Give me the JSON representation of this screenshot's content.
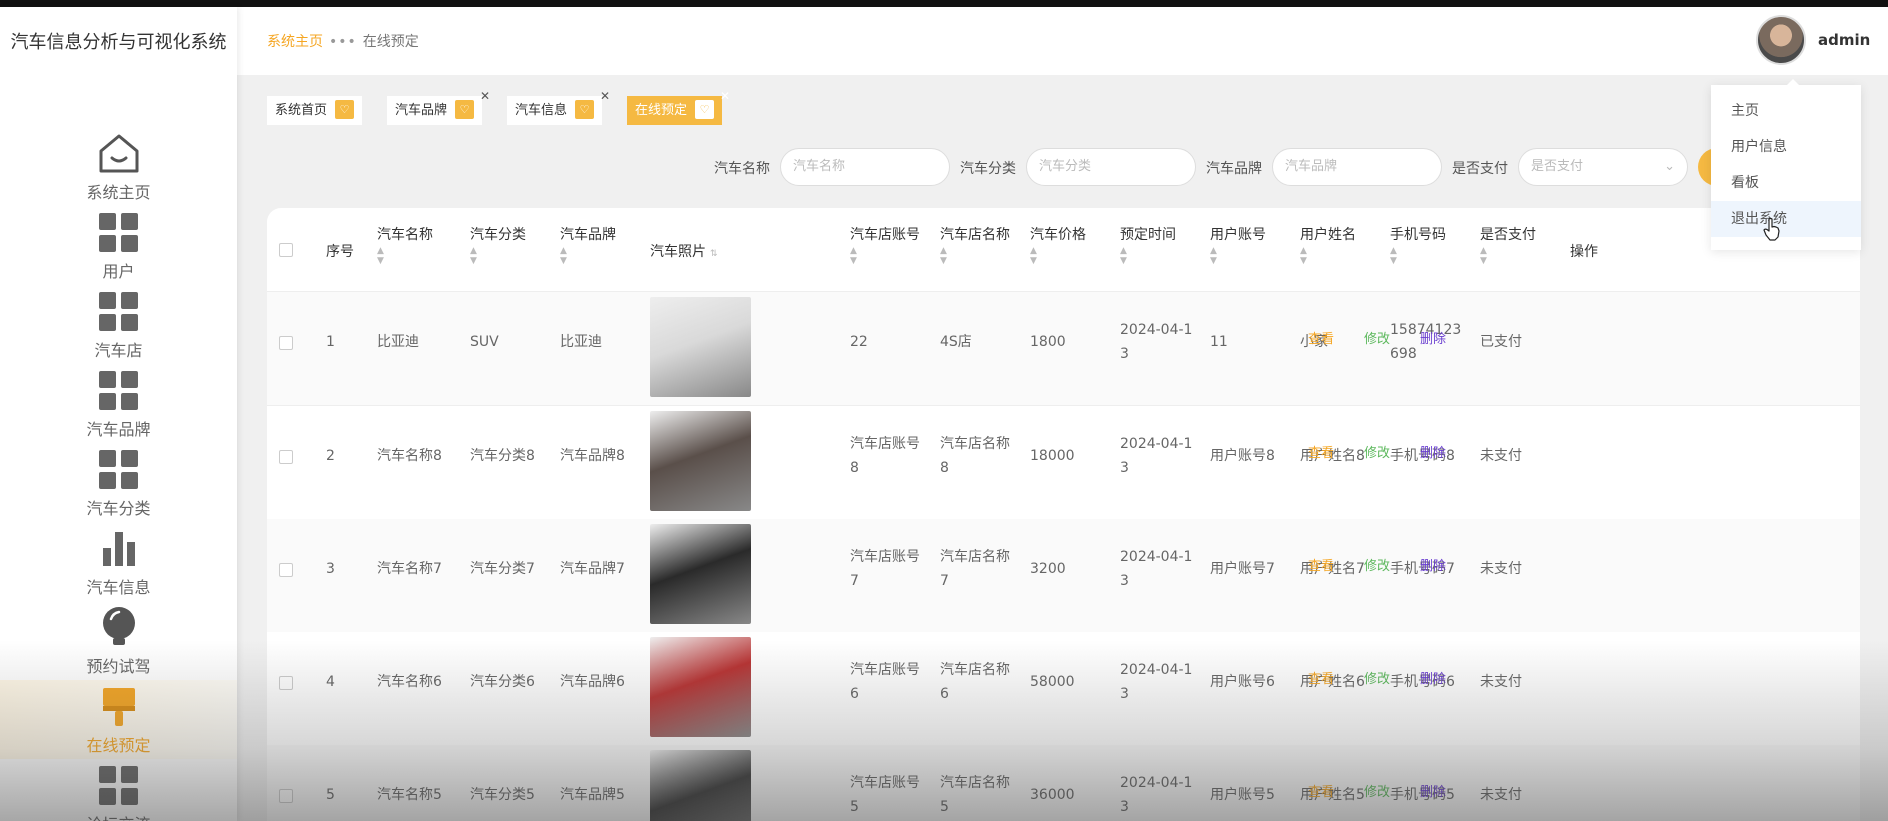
{
  "app": {
    "title": "汽车信息分析与可视化系统"
  },
  "sidebar": {
    "items": [
      {
        "label": "系统主页",
        "icon": "house-icon"
      },
      {
        "label": "用户",
        "icon": "grid-icon"
      },
      {
        "label": "汽车店",
        "icon": "grid-icon"
      },
      {
        "label": "汽车品牌",
        "icon": "grid-icon"
      },
      {
        "label": "汽车分类",
        "icon": "grid-icon"
      },
      {
        "label": "汽车信息",
        "icon": "bar-chart-icon"
      },
      {
        "label": "预约试驾",
        "icon": "lightbulb-icon"
      },
      {
        "label": "在线预定",
        "icon": "brush-icon",
        "active": true
      },
      {
        "label": "论坛交流",
        "icon": "grid-icon"
      }
    ]
  },
  "header": {
    "breadcrumb": {
      "home": "系统主页",
      "separator": "•••",
      "current": "在线预定"
    },
    "username": "admin"
  },
  "tags": [
    {
      "label": "系统首页"
    },
    {
      "label": "汽车品牌"
    },
    {
      "label": "汽车信息"
    },
    {
      "label": "在线预定",
      "active": true
    }
  ],
  "search": {
    "fields": [
      {
        "label": "汽车名称",
        "placeholder": "汽车名称"
      },
      {
        "label": "汽车分类",
        "placeholder": "汽车分类"
      },
      {
        "label": "汽车品牌",
        "placeholder": "汽车品牌"
      },
      {
        "label": "是否支付",
        "placeholder": "是否支付"
      }
    ]
  },
  "table": {
    "headers": [
      "序号",
      "汽车名称",
      "汽车分类",
      "汽车品牌",
      "汽车照片",
      "汽车店账号",
      "汽车店名称",
      "汽车价格",
      "预定时间",
      "用户账号",
      "用户姓名",
      "手机号码",
      "是否支付",
      "操作"
    ],
    "rows": [
      {
        "no": "1",
        "name": "比亚迪",
        "cat": "SUV",
        "brand": "比亚迪",
        "store_acc": "22",
        "store_name": "4S店",
        "price": "1800",
        "time": "2024-04-13",
        "user_acc": "11",
        "user_name": "小家",
        "phone": "15874123698",
        "paid": "已支付",
        "photo_color": "#d9d9d9"
      },
      {
        "no": "2",
        "name": "汽车名称8",
        "cat": "汽车分类8",
        "brand": "汽车品牌8",
        "store_acc": "汽车店账号8",
        "store_name": "汽车店名称8",
        "price": "18000",
        "time": "2024-04-13",
        "user_acc": "用户账号8",
        "user_name": "用户姓名8",
        "phone": "手机号码8",
        "paid": "未支付",
        "photo_color": "#5a4f4a"
      },
      {
        "no": "3",
        "name": "汽车名称7",
        "cat": "汽车分类7",
        "brand": "汽车品牌7",
        "store_acc": "汽车店账号7",
        "store_name": "汽车店名称7",
        "price": "3200",
        "time": "2024-04-13",
        "user_acc": "用户账号7",
        "user_name": "用户姓名7",
        "phone": "手机号码7",
        "paid": "未支付",
        "photo_color": "#2a2a2a"
      },
      {
        "no": "4",
        "name": "汽车名称6",
        "cat": "汽车分类6",
        "brand": "汽车品牌6",
        "store_acc": "汽车店账号6",
        "store_name": "汽车店名称6",
        "price": "58000",
        "time": "2024-04-13",
        "user_acc": "用户账号6",
        "user_name": "用户姓名6",
        "phone": "手机号码6",
        "paid": "未支付",
        "photo_color": "#b83232"
      },
      {
        "no": "5",
        "name": "汽车名称5",
        "cat": "汽车分类5",
        "brand": "汽车品牌5",
        "store_acc": "汽车店账号5",
        "store_name": "汽车店名称5",
        "price": "36000",
        "time": "2024-04-13",
        "user_acc": "用户账号5",
        "user_name": "用户姓名5",
        "phone": "手机号码5",
        "paid": "未支付",
        "photo_color": "#3a3a3a"
      }
    ],
    "actions": {
      "view": "查看",
      "edit": "修改",
      "delete": "删除"
    }
  },
  "user_menu": {
    "items": [
      "主页",
      "用户信息",
      "看板",
      "退出系统"
    ],
    "hovered": "退出系统"
  },
  "colors": {
    "accent": "#f5b942",
    "edit": "#5cb85c",
    "delete": "#6a3fd0"
  }
}
